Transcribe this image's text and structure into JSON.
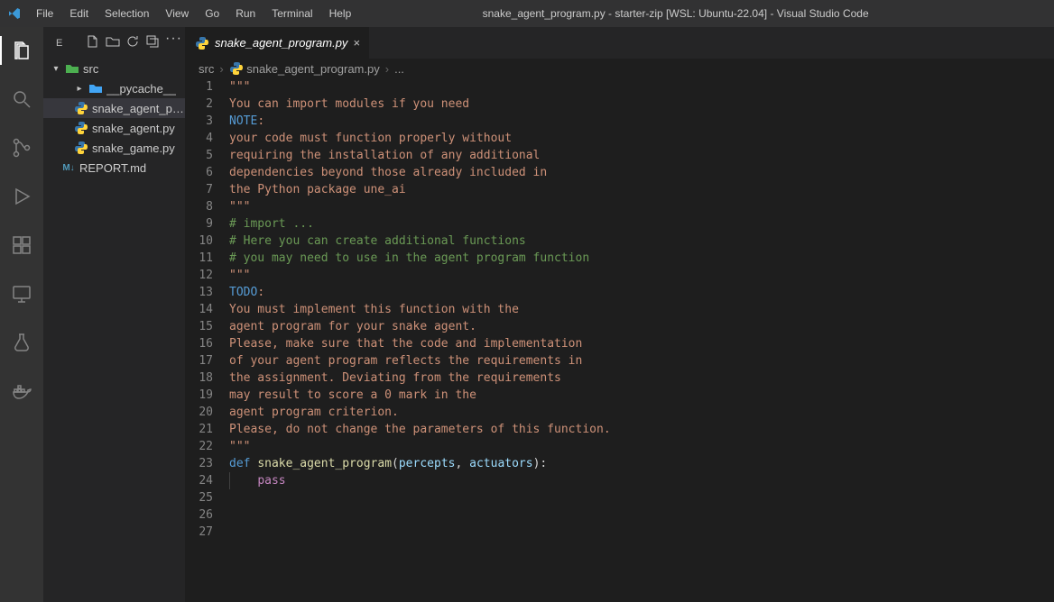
{
  "titlebar": {
    "menus": [
      "File",
      "Edit",
      "Selection",
      "View",
      "Go",
      "Run",
      "Terminal",
      "Help"
    ],
    "title": "snake_agent_program.py - starter-zip [WSL: Ubuntu-22.04] - Visual Studio Code"
  },
  "activitybar": {
    "items": [
      {
        "name": "explorer-icon",
        "active": true
      },
      {
        "name": "search-icon",
        "active": false
      },
      {
        "name": "scm-icon",
        "active": false
      },
      {
        "name": "run-icon",
        "active": false
      },
      {
        "name": "extensions-icon",
        "active": false
      },
      {
        "name": "remote-explorer-icon",
        "active": false
      },
      {
        "name": "testing-icon",
        "active": false
      },
      {
        "name": "docker-icon",
        "active": false
      }
    ]
  },
  "sidebar": {
    "header_label": "E",
    "root": {
      "name": "src",
      "expanded": true
    },
    "items": [
      {
        "kind": "folder",
        "name": "__pycache__",
        "expanded": false,
        "depth": 1
      },
      {
        "kind": "py",
        "name": "snake_agent_pr...",
        "selected": true,
        "depth": 1
      },
      {
        "kind": "py",
        "name": "snake_agent.py",
        "depth": 1
      },
      {
        "kind": "py",
        "name": "snake_game.py",
        "depth": 1
      },
      {
        "kind": "md",
        "name": "REPORT.md",
        "depth": 0
      }
    ]
  },
  "tabs": {
    "open": [
      {
        "label": "snake_agent_program.py",
        "lang": "py",
        "active": true
      }
    ]
  },
  "breadcrumbs": {
    "parts": [
      "src",
      "snake_agent_program.py",
      "..."
    ]
  },
  "editor": {
    "language": "python",
    "line_count": 27,
    "lines": [
      {
        "n": 1,
        "t": "\"\"\"",
        "cls": "str"
      },
      {
        "n": 2,
        "t": "You can import modules if you need",
        "cls": "str"
      },
      {
        "n": 3,
        "segments": [
          {
            "t": "NOTE",
            "cls": "note"
          },
          {
            "t": ":",
            "cls": "str"
          }
        ]
      },
      {
        "n": 4,
        "t": "your code must function properly without",
        "cls": "str"
      },
      {
        "n": 5,
        "t": "requiring the installation of any additional",
        "cls": "str"
      },
      {
        "n": 6,
        "t": "dependencies beyond those already included in",
        "cls": "str"
      },
      {
        "n": 7,
        "t": "the Python package une_ai",
        "cls": "str"
      },
      {
        "n": 8,
        "t": "\"\"\"",
        "cls": "str"
      },
      {
        "n": 9,
        "t": "# import ...",
        "cls": "cmt"
      },
      {
        "n": 10,
        "t": "",
        "cls": ""
      },
      {
        "n": 11,
        "t": "# Here you can create additional functions",
        "cls": "cmt"
      },
      {
        "n": 12,
        "t": "# you may need to use in the agent program function",
        "cls": "cmt"
      },
      {
        "n": 13,
        "t": "",
        "cls": ""
      },
      {
        "n": 14,
        "t": "\"\"\"",
        "cls": "str"
      },
      {
        "n": 15,
        "segments": [
          {
            "t": "TODO",
            "cls": "note"
          },
          {
            "t": ":",
            "cls": "str"
          }
        ]
      },
      {
        "n": 16,
        "t": "You must implement this function with the",
        "cls": "str"
      },
      {
        "n": 17,
        "t": "agent program for your snake agent.",
        "cls": "str"
      },
      {
        "n": 18,
        "t": "Please, make sure that the code and implementation",
        "cls": "str"
      },
      {
        "n": 19,
        "t": "of your agent program reflects the requirements in",
        "cls": "str"
      },
      {
        "n": 20,
        "t": "the assignment. Deviating from the requirements",
        "cls": "str"
      },
      {
        "n": 21,
        "t": "may result to score a 0 mark in the",
        "cls": "str"
      },
      {
        "n": 22,
        "t": "agent program criterion.",
        "cls": "str"
      },
      {
        "n": 23,
        "t": "",
        "cls": "str"
      },
      {
        "n": 24,
        "t": "Please, do not change the parameters of this function.",
        "cls": "str"
      },
      {
        "n": 25,
        "t": "\"\"\"",
        "cls": "str"
      },
      {
        "n": 26,
        "segments": [
          {
            "t": "def ",
            "cls": "kw"
          },
          {
            "t": "snake_agent_program",
            "cls": "fn"
          },
          {
            "t": "(",
            "cls": ""
          },
          {
            "t": "percepts",
            "cls": "var"
          },
          {
            "t": ", ",
            "cls": ""
          },
          {
            "t": "actuators",
            "cls": "var"
          },
          {
            "t": "):",
            "cls": ""
          }
        ]
      },
      {
        "n": 27,
        "indent": 4,
        "segments": [
          {
            "t": "pass",
            "cls": "pass"
          }
        ]
      }
    ]
  }
}
